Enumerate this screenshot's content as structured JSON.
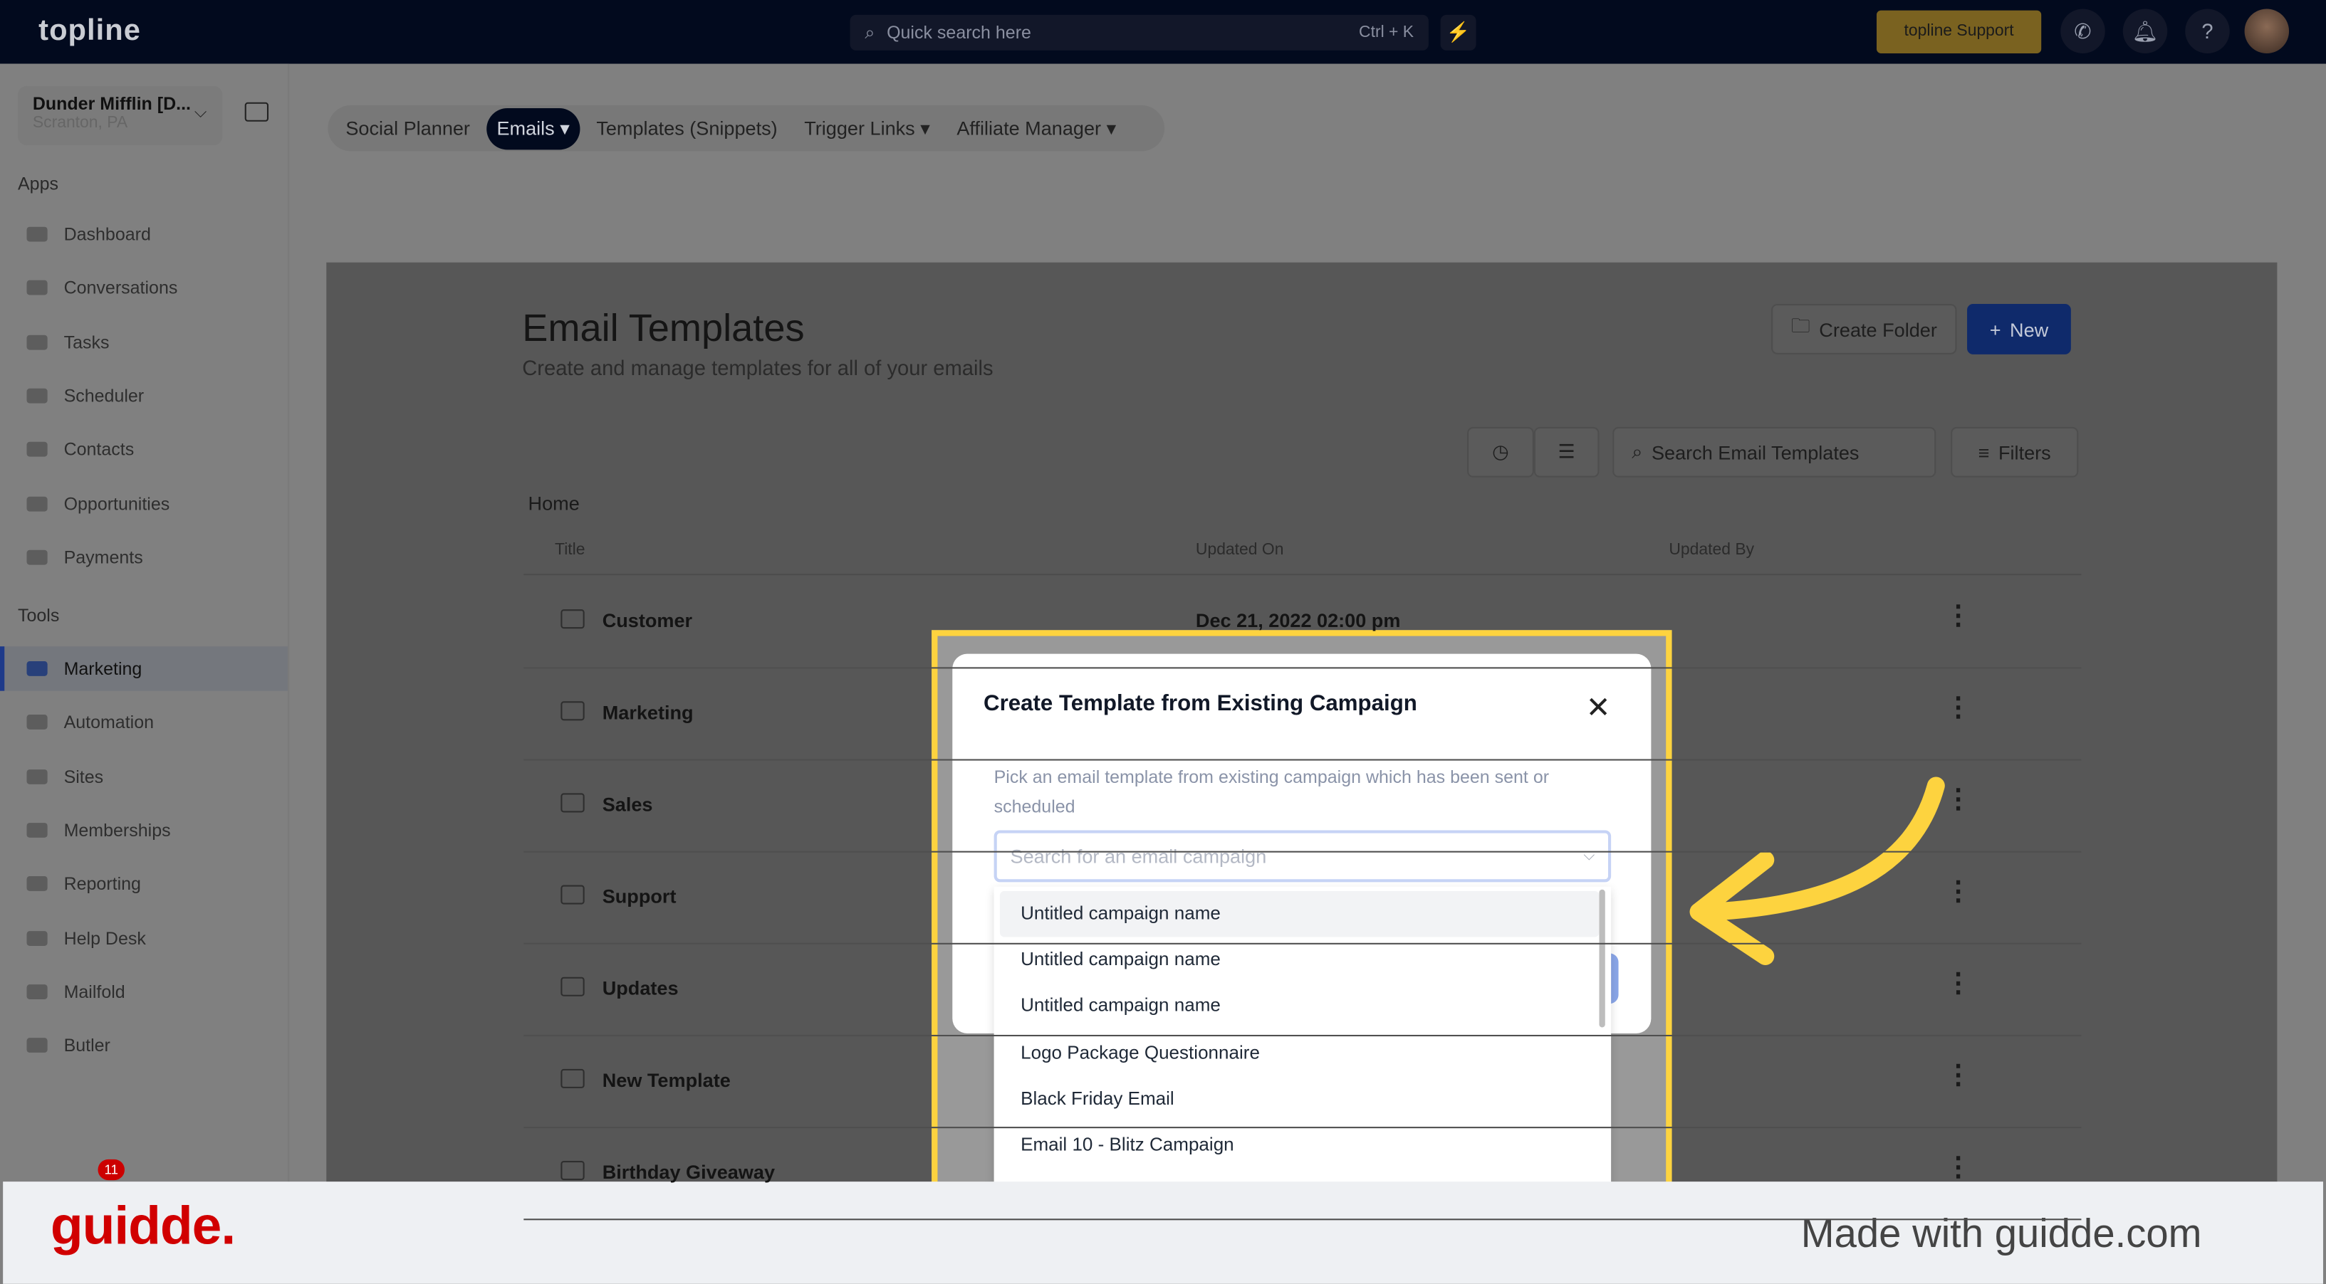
{
  "topbar": {
    "logo": "topline",
    "search_placeholder": "Quick search here",
    "shortcut": "Ctrl + K",
    "support_label": "topline Support"
  },
  "sidebar": {
    "account_name": "Dunder Mifflin [D...",
    "account_location": "Scranton, PA",
    "apps_heading": "Apps",
    "tools_heading": "Tools",
    "apps": [
      {
        "label": "Dashboard"
      },
      {
        "label": "Conversations"
      },
      {
        "label": "Tasks"
      },
      {
        "label": "Scheduler"
      },
      {
        "label": "Contacts"
      },
      {
        "label": "Opportunities"
      },
      {
        "label": "Payments"
      }
    ],
    "tools": [
      {
        "label": "Marketing",
        "active": true
      },
      {
        "label": "Automation"
      },
      {
        "label": "Sites"
      },
      {
        "label": "Memberships"
      },
      {
        "label": "Reporting"
      },
      {
        "label": "Help Desk"
      },
      {
        "label": "Mailfold"
      },
      {
        "label": "Butler"
      }
    ],
    "notification_count": "11"
  },
  "tabs": [
    {
      "label": "Social Planner"
    },
    {
      "label": "Emails ▾",
      "active": true
    },
    {
      "label": "Templates (Snippets)"
    },
    {
      "label": "Trigger Links ▾"
    },
    {
      "label": "Affiliate Manager ▾"
    }
  ],
  "main": {
    "title": "Email Templates",
    "subtitle": "Create and manage templates for all of your emails",
    "create_folder": "Create Folder",
    "new": "New",
    "search_placeholder": "Search Email Templates",
    "filters": "Filters",
    "breadcrumb": "Home",
    "columns": [
      "Title",
      "Updated On",
      "Updated By"
    ],
    "rows": [
      {
        "title": "Customer",
        "updated": "Dec 21, 2022 02:00 pm"
      },
      {
        "title": "Marketing"
      },
      {
        "title": "Sales"
      },
      {
        "title": "Support"
      },
      {
        "title": "Updates"
      },
      {
        "title": "New Template"
      },
      {
        "title": "Birthday Giveaway"
      }
    ]
  },
  "modal": {
    "title": "Create Template from Existing Campaign",
    "description": "Pick an email template from existing campaign which has been sent or scheduled",
    "select_placeholder": "Search for an email campaign",
    "options": [
      "Untitled campaign name",
      "Untitled campaign name",
      "Untitled campaign name",
      "Logo Package Questionnaire",
      "Black Friday Email",
      "Email 10 - Blitz Campaign"
    ]
  },
  "footer": {
    "logo": "guidde.",
    "tagline": "Made with guidde.com"
  },
  "colors": {
    "highlight": "#fdd33f",
    "topbar": "#020a1e",
    "brand_red": "#d10000"
  }
}
